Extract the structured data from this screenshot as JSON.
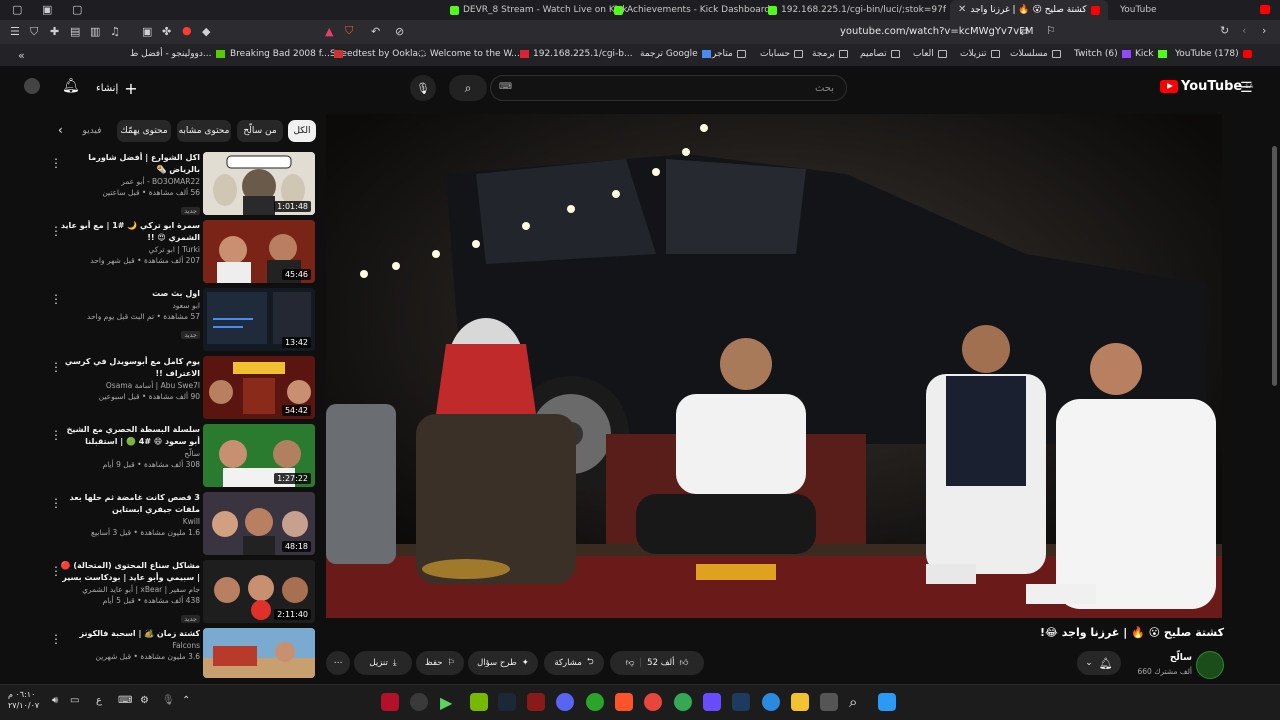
{
  "tabs": [
    {
      "title": "DEVR_8 Stream - Watch Live on Kick",
      "color": "#53fc18"
    },
    {
      "title": "Achievements - Kick Dashboard",
      "color": "#53fc18"
    },
    {
      "title": "192.168.225.1/cgi-bin/luci/;stok=97f",
      "color": "#53fc18"
    },
    {
      "title": "كشتة صليح 😮 🔥 | غرزنا واجد",
      "color": "#ff0000",
      "active": true
    },
    {
      "title": "YouTube",
      "color": "#ff0000"
    }
  ],
  "address": {
    "url": "youtube.com/watch?v=kcMWgYv7vFM"
  },
  "bookmarks": [
    "YouTube (178)",
    "Kick",
    "Twitch (6)",
    "مسلسلات",
    "تنزيلات",
    "العاب",
    "تصاميم",
    "برمجة",
    "حسابات",
    "متاجر",
    "ترجمة Google",
    "192.168.225.1/cgi-b...",
    "Welcome to the W...",
    "Speedtest by Ookla...",
    "Breaking Bad 2008 f...",
    "دوولينجو - أفضل ط..."
  ],
  "youtube": {
    "logo_text": "YouTube",
    "logo_region": "SA",
    "search_placeholder": "بحث",
    "create_label": "إنشاء",
    "chips": [
      "الكل",
      "من سالّح",
      "محتوى مشابه",
      "محتوى يهمّك",
      "فيديو"
    ],
    "recommendations": [
      {
        "title": "اكل الشوارع | أفضل شاورما بالرياض 🌯",
        "channel": "BO3OMAR22 - أبو عمر",
        "stats": "56 ألف مشاهدة • قبل ساعتين",
        "badge": "جديد",
        "duration": "1:01:48",
        "thumb_color": "#d8d3c8"
      },
      {
        "title": "سمرة ابو تركي 🌙 #1 | مع أبو عايد الشمري 😍 !!",
        "channel": "Turki | ابو تركي",
        "stats": "207 ألف مشاهدة • قبل شهر واحد",
        "badge": "",
        "duration": "45:46",
        "thumb_color": "#8a2a1a"
      },
      {
        "title": "اول بث صت",
        "channel": "ابو سعود",
        "stats": "57 مشاهدة • تم البث قبل يوم واحد",
        "badge": "جديد",
        "duration": "13:42",
        "thumb_color": "#1f2a3a"
      },
      {
        "title": "يوم كامل مع أبوسويدل في كرسي الاعتراف !!",
        "channel": "Abu Swe7l | أسامة Osama",
        "stats": "90 ألف مشاهدة • قبل اسبوعين",
        "badge": "",
        "duration": "54:42",
        "thumb_color": "#6a1a14"
      },
      {
        "title": "سلسلة البسطة الحصري مع الشيخ أبو سعود 😄 #4 🟢 | استقبلنا اتصالات المتابع...",
        "channel": "سالّح",
        "stats": "308 ألف مشاهدة • قبل 9 أيام",
        "badge": "",
        "duration": "1:27:22",
        "thumb_color": "#2a6a2a"
      },
      {
        "title": "3 قصص كانت غامضة ثم حلها بعد ملفات جيفري ابستاين",
        "channel": "Kwill",
        "stats": "1.6 مليون مشاهدة • قبل 3 أسابيع",
        "badge": "",
        "duration": "48:18",
        "thumb_color": "#3a2a3a"
      },
      {
        "title": "مشاكل سناع المحتوى (المتحالة) 🔴 | سبيمي وأبو عايد | بودكاست بسير خير",
        "channel": "جام سفير | xBear | أبو عايد الشمري",
        "stats": "438 ألف مشاهدة • قبل 5 أيام",
        "badge": "جديد",
        "duration": "2:11:40",
        "thumb_color": "#2a2a2a"
      },
      {
        "title": "كشتة زمان 🏕️ | اسحبة فالكونز",
        "channel": "Falcons",
        "stats": "3.6 مليون مشاهدة • قبل شهرين",
        "badge": "",
        "duration": "",
        "thumb_color": "#5a8ab0"
      }
    ],
    "video": {
      "title": "كشتة صليح 😮 🔥 | غرزنا واجد 😂!",
      "channel_name": "سالّح",
      "subscribers": "660 ألف مشترك",
      "likes": "52 ألف",
      "share_label": "مشاركة",
      "ask_label": "طرح سؤال",
      "save_label": "حفظ",
      "download_label": "تنزيل"
    }
  },
  "taskbar": {
    "time": "٠٦:١٠ م",
    "date": "٢٧/١٠/٠٧",
    "lang": "ع"
  }
}
